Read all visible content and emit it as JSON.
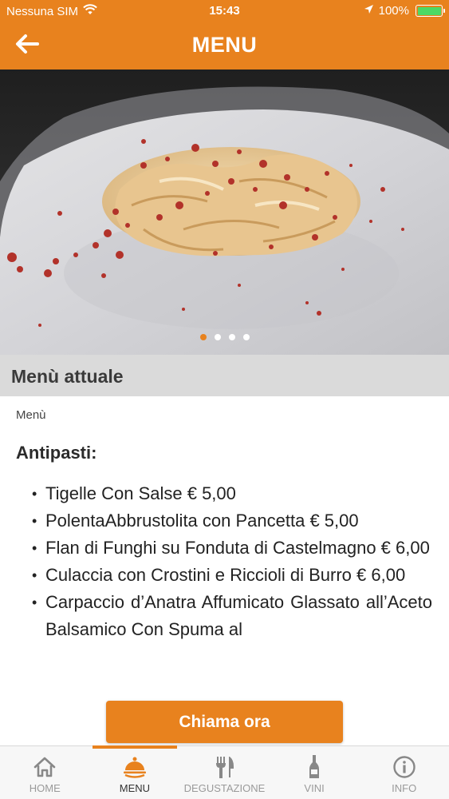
{
  "status_bar": {
    "carrier": "Nessuna SIM",
    "time": "15:43",
    "battery": "100%",
    "battery_level": 1.0
  },
  "nav": {
    "title": "MENU",
    "back_icon": "arrow-left-icon"
  },
  "carousel": {
    "page_count": 4,
    "active_index": 0
  },
  "section": {
    "title": "Menù attuale"
  },
  "content": {
    "breadcrumb": "Menù",
    "category": "Antipasti:",
    "items": [
      "Tigelle Con Salse € 5,00",
      "PolentaAbbrustolita con Pancetta € 5,00",
      "Flan di Funghi su Fonduta di Castelmagno € 6,00",
      "Culaccia con Crostini e Riccioli di Burro € 6,00",
      "Carpaccio d’Anatra Affumicato Glassato all’Aceto Balsamico Con Spuma al"
    ]
  },
  "call_button": {
    "label": "Chiama ora"
  },
  "tab_bar": {
    "tabs": [
      {
        "label": "HOME",
        "icon": "home-icon",
        "active": false
      },
      {
        "label": "MENU",
        "icon": "cloche-icon",
        "active": true
      },
      {
        "label": "DEGUSTAZIONE",
        "icon": "fork-knife-icon",
        "active": false
      },
      {
        "label": "VINI",
        "icon": "wine-bottle-icon",
        "active": false
      },
      {
        "label": "INFO",
        "icon": "info-icon",
        "active": false
      }
    ]
  },
  "colors": {
    "accent": "#E8821E",
    "section_bg": "#DADADA",
    "tab_inactive": "#9a9a9a",
    "tab_active": "#333333"
  }
}
